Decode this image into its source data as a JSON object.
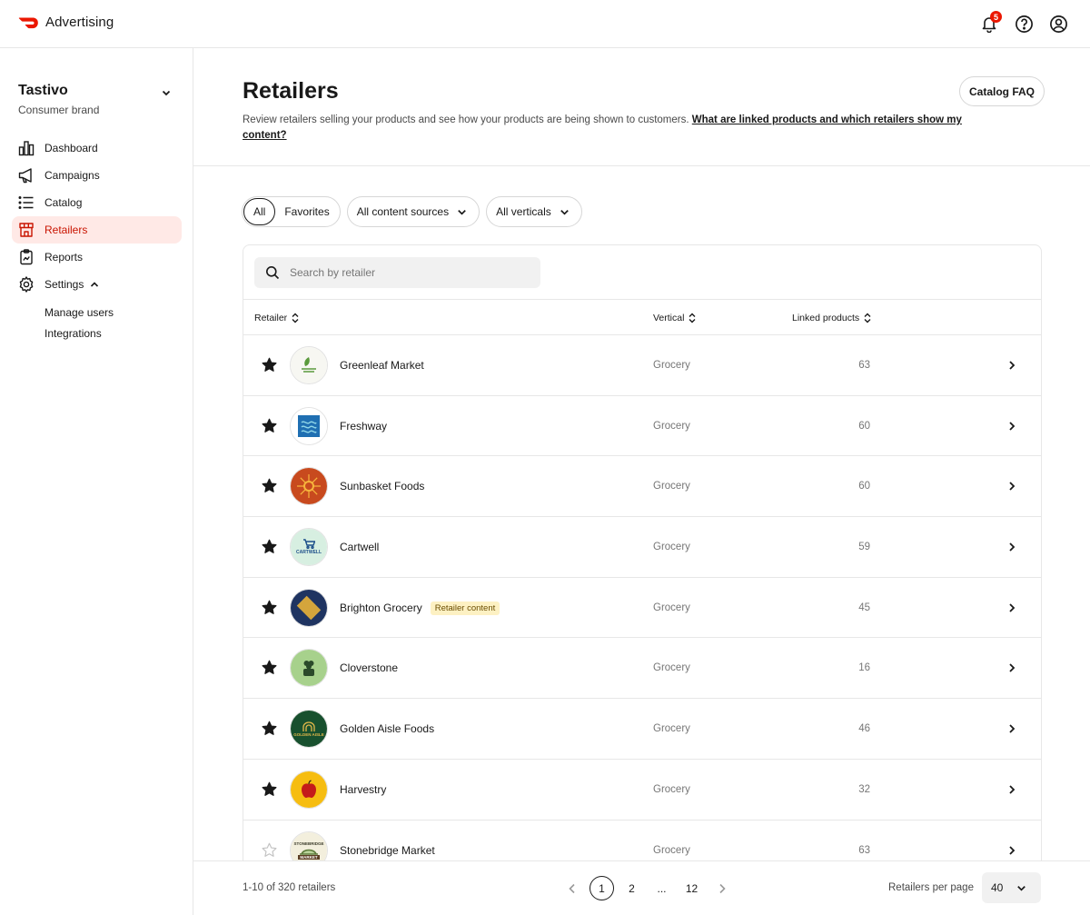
{
  "topbar": {
    "brand": "Advertising",
    "notification_count": "5",
    "icons": [
      "bell-icon",
      "help-icon",
      "account-icon"
    ]
  },
  "sidebar": {
    "org_name": "Tastivo",
    "org_type": "Consumer brand",
    "items": [
      {
        "label": "Dashboard",
        "icon": "bar-chart-icon"
      },
      {
        "label": "Campaigns",
        "icon": "megaphone-icon"
      },
      {
        "label": "Catalog",
        "icon": "list-icon"
      },
      {
        "label": "Retailers",
        "icon": "store-icon",
        "active": true
      },
      {
        "label": "Reports",
        "icon": "clipboard-icon"
      },
      {
        "label": "Settings",
        "icon": "gear-icon",
        "expanded": true
      }
    ],
    "settings_sub": [
      {
        "label": "Manage users"
      },
      {
        "label": "Integrations"
      }
    ]
  },
  "header": {
    "title": "Retailers",
    "description": "Review retailers selling your products and see how your products are being shown to customers.",
    "link_text": "What are linked products and which retailers show my content?",
    "faq_label": "Catalog FAQ"
  },
  "filters": {
    "all_label": "All",
    "favorites_label": "Favorites",
    "content_sources_label": "All content sources",
    "verticals_label": "All verticals"
  },
  "search": {
    "placeholder": "Search by retailer"
  },
  "table": {
    "columns": {
      "retailer": "Retailer",
      "vertical": "Vertical",
      "linked": "Linked products"
    },
    "rows": [
      {
        "name": "Greenleaf Market",
        "vertical": "Grocery",
        "linked": "63",
        "favorite": true,
        "tag": ""
      },
      {
        "name": "Freshway",
        "vertical": "Grocery",
        "linked": "60",
        "favorite": true,
        "tag": ""
      },
      {
        "name": "Sunbasket Foods",
        "vertical": "Grocery",
        "linked": "60",
        "favorite": true,
        "tag": ""
      },
      {
        "name": "Cartwell",
        "vertical": "Grocery",
        "linked": "59",
        "favorite": true,
        "tag": ""
      },
      {
        "name": "Brighton Grocery",
        "vertical": "Grocery",
        "linked": "45",
        "favorite": true,
        "tag": "Retailer content"
      },
      {
        "name": "Cloverstone",
        "vertical": "Grocery",
        "linked": "16",
        "favorite": true,
        "tag": ""
      },
      {
        "name": "Golden Aisle Foods",
        "vertical": "Grocery",
        "linked": "46",
        "favorite": true,
        "tag": ""
      },
      {
        "name": "Harvestry",
        "vertical": "Grocery",
        "linked": "32",
        "favorite": true,
        "tag": ""
      },
      {
        "name": "Stonebridge Market",
        "vertical": "Grocery",
        "linked": "63",
        "favorite": false,
        "tag": ""
      }
    ]
  },
  "footer": {
    "count_text": "1-10 of 320 retailers",
    "pages": [
      "1",
      "2",
      "...",
      "12"
    ],
    "current_page": "1",
    "per_page_label": "Retailers per page",
    "per_page_value": "40"
  },
  "colors": {
    "accent": "#eb1700",
    "active_bg": "#ffe9e6",
    "tag_bg": "#fdf1c3"
  }
}
